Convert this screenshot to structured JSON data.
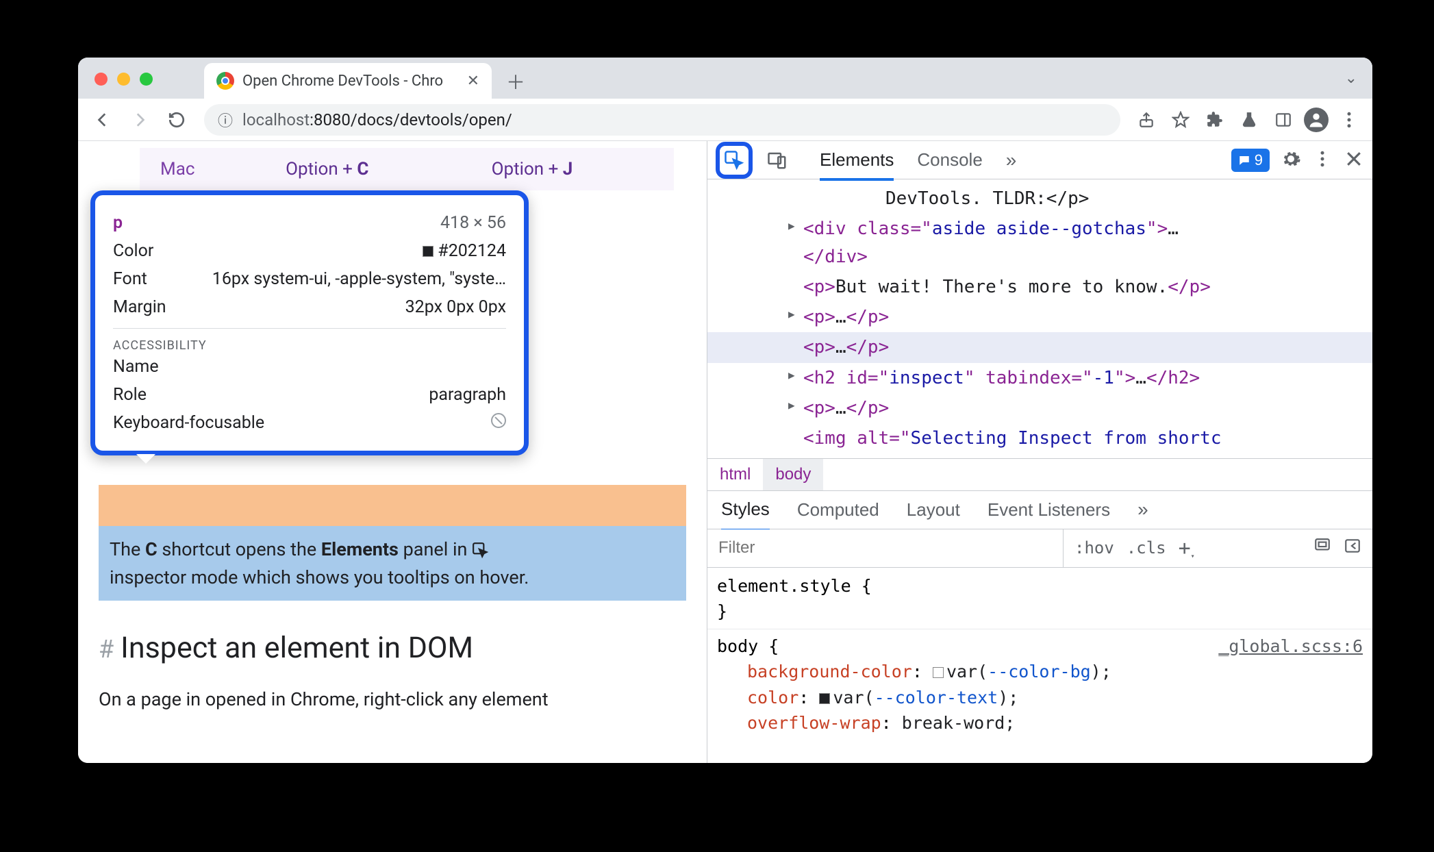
{
  "tab": {
    "title": "Open Chrome DevTools - Chro"
  },
  "url": {
    "host": "localhost",
    "port_path": ":8080/docs/devtools/open/"
  },
  "page": {
    "shortcut_row": {
      "os": "Mac",
      "col1_pre": "Option + ",
      "col1_key": "C",
      "col2_pre": "Option + ",
      "col2_key": "J"
    },
    "para_row1_a": "The ",
    "para_row1_b": "C",
    "para_row1_c": " shortcut opens the ",
    "para_row1_d": "Elements",
    "para_row1_e": " panel in ",
    "para_row2": "inspector mode which shows you tooltips on hover.",
    "h2": "Inspect an element in DOM",
    "body": "On a page in opened in Chrome, right-click any element"
  },
  "tooltip": {
    "tag": "p",
    "dims": "418 × 56",
    "color_label": "Color",
    "color_val": "#202124",
    "font_label": "Font",
    "font_val": "16px system-ui, -apple-system, \"syste…",
    "margin_label": "Margin",
    "margin_val": "32px 0px 0px",
    "acc_header": "ACCESSIBILITY",
    "name_label": "Name",
    "name_val": "",
    "role_label": "Role",
    "role_val": "paragraph",
    "kbd_label": "Keyboard-focusable"
  },
  "devtools": {
    "tabs": {
      "elements": "Elements",
      "console": "Console"
    },
    "issues": "9",
    "dom": {
      "l1": "DevTools. TLDR:</p>",
      "l2a": "<div class=\"",
      "l2b": "aside aside--gotchas",
      "l2c": "\">",
      "l2d": "…",
      "l2e": "</div>",
      "l3a": "<p>",
      "l3b": "But wait! There's more to know.",
      "l3c": "</p>",
      "l4a": "<p>",
      "l4b": "…",
      "l4c": "</p>",
      "l5a": "<p>",
      "l5b": "…",
      "l5c": "</p>",
      "l6a": "<h2 id=\"",
      "l6b": "inspect",
      "l6c": "\" tabindex=\"",
      "l6d": "-1",
      "l6e": "\">",
      "l6f": "…",
      "l6g": "</h2>",
      "l7a": "<p>",
      "l7b": "…",
      "l7c": "</p>",
      "l8a": "<img alt=\"",
      "l8b": "Selecting Inspect from shortc"
    },
    "breadcrumb": {
      "a": "html",
      "b": "body"
    },
    "styles_tabs": {
      "a": "Styles",
      "b": "Computed",
      "c": "Layout",
      "d": "Event Listeners"
    },
    "filter_placeholder": "Filter",
    "hov": ":hov",
    "cls": ".cls",
    "elstyle_open": "element.style {",
    "elstyle_close": "}",
    "rule_sel": "body {",
    "rule_src": "_global.scss:6",
    "p1": "background-color",
    "v1a": "var(",
    "v1b": "--color-bg",
    "v1c": ");",
    "p2": "color",
    "v2a": "var(",
    "v2b": "--color-text",
    "v2c": ");",
    "p3": "overflow-wrap",
    "v3": "break-word;"
  }
}
